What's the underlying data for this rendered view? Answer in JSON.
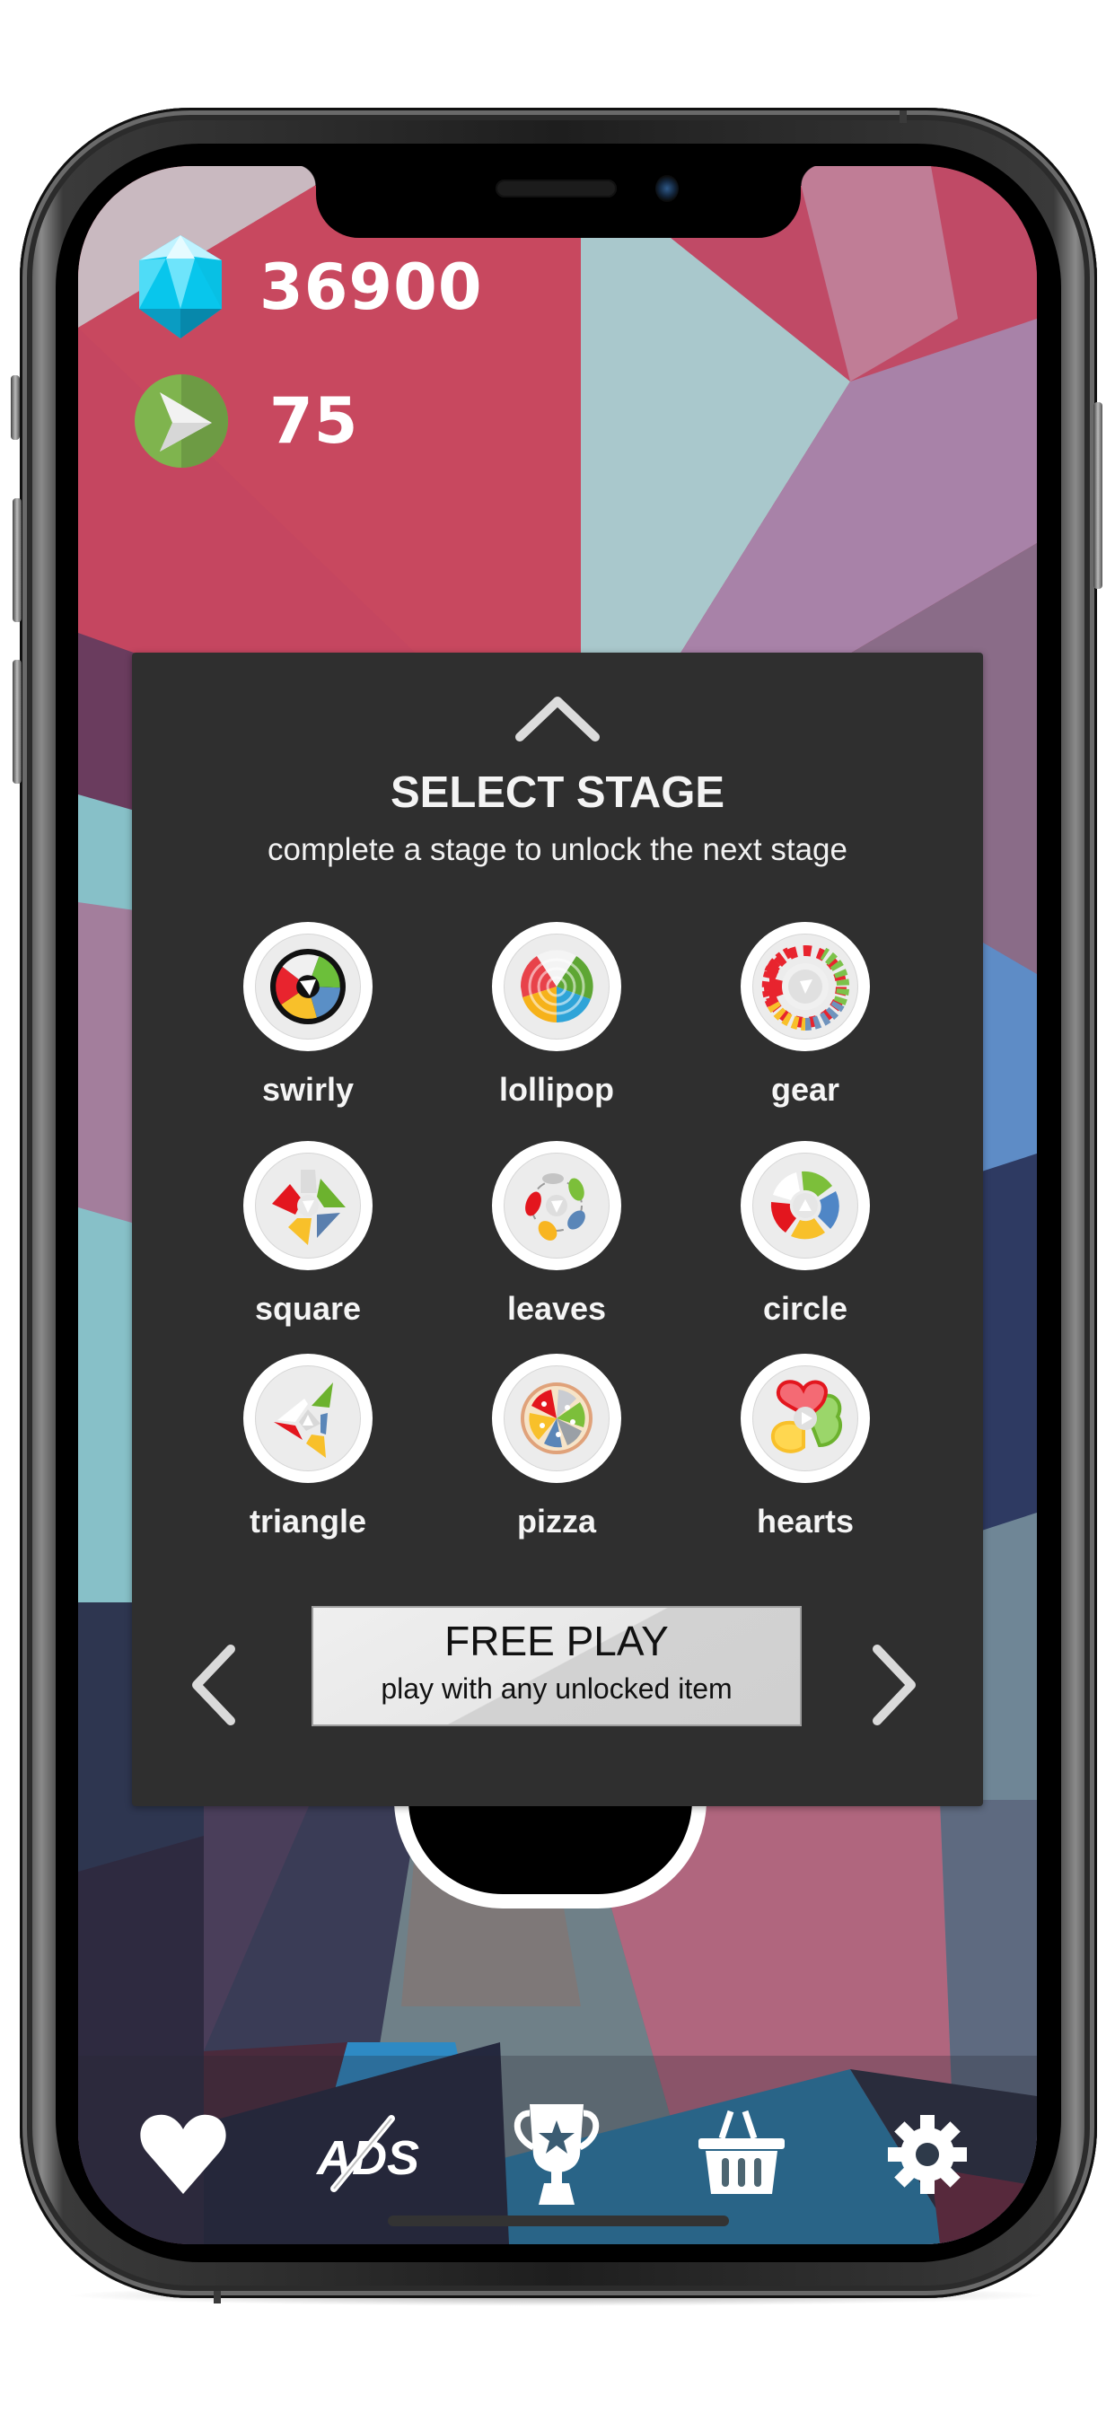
{
  "stats": {
    "gems": {
      "icon": "diamond-gem-icon",
      "value": "36900"
    },
    "moves": {
      "icon": "green-arrow-icon",
      "value": "75"
    }
  },
  "panel": {
    "collapse_icon": "chevron-up-icon",
    "title": "SELECT STAGE",
    "subtitle": "complete a stage to unlock the next stage",
    "stages": [
      {
        "label": "swirly"
      },
      {
        "label": "lollipop"
      },
      {
        "label": "gear"
      },
      {
        "label": "square"
      },
      {
        "label": "leaves"
      },
      {
        "label": "circle"
      },
      {
        "label": "triangle"
      },
      {
        "label": "pizza"
      },
      {
        "label": "hearts"
      }
    ],
    "prev_icon": "chevron-left-icon",
    "next_icon": "chevron-right-icon",
    "free_play": {
      "title": "FREE PLAY",
      "subtitle": "play with any unlocked item"
    }
  },
  "bottom_bar": {
    "items": [
      {
        "name": "heart",
        "icon": "heart-icon"
      },
      {
        "name": "no-ads",
        "icon": "no-ads-icon"
      },
      {
        "name": "trophy",
        "icon": "trophy-icon"
      },
      {
        "name": "shop",
        "icon": "basket-icon"
      },
      {
        "name": "settings",
        "icon": "gear-icon"
      }
    ]
  },
  "colors": {
    "panel_bg": "#2f2f2f",
    "red": "#e8242e",
    "green": "#6cbf3a",
    "blue": "#5a8fc6",
    "yellow": "#f8c02a",
    "gem": "#3fd4f4"
  }
}
